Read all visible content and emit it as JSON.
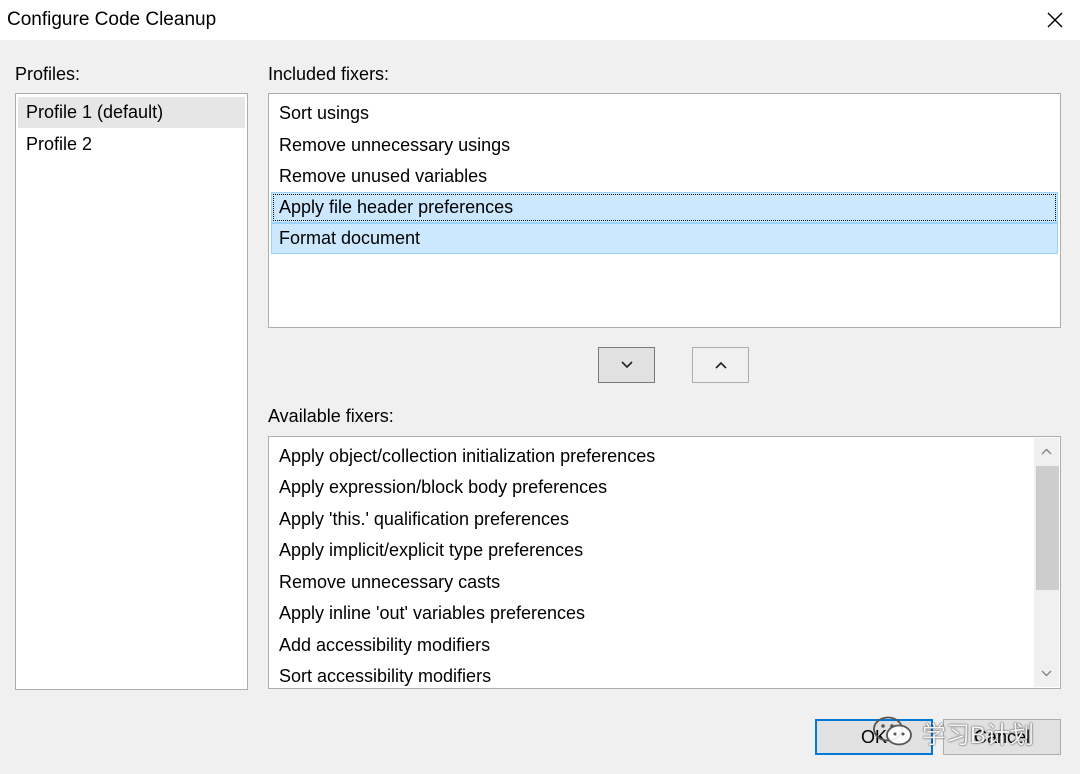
{
  "window": {
    "title": "Configure Code Cleanup",
    "close_icon": "close-icon"
  },
  "profiles": {
    "label": "Profiles:",
    "items": [
      {
        "label": "Profile 1 (default)",
        "selected": true
      },
      {
        "label": "Profile 2",
        "selected": false
      }
    ]
  },
  "included": {
    "label": "Included fixers:",
    "items": [
      {
        "label": "Sort usings",
        "selected": false
      },
      {
        "label": "Remove unnecessary usings",
        "selected": false
      },
      {
        "label": "Remove unused variables",
        "selected": false
      },
      {
        "label": "Apply file header preferences",
        "selected": true,
        "focused": true
      },
      {
        "label": "Format document",
        "selected": true
      }
    ]
  },
  "move_buttons": {
    "down_icon": "chevron-down-icon",
    "up_icon": "chevron-up-icon"
  },
  "available": {
    "label": "Available fixers:",
    "items": [
      {
        "label": "Apply object/collection initialization preferences"
      },
      {
        "label": "Apply expression/block body preferences"
      },
      {
        "label": "Apply 'this.' qualification preferences"
      },
      {
        "label": "Apply implicit/explicit type preferences"
      },
      {
        "label": "Remove unnecessary casts"
      },
      {
        "label": "Apply inline 'out' variables preferences"
      },
      {
        "label": "Add accessibility modifiers"
      },
      {
        "label": "Sort accessibility modifiers"
      }
    ]
  },
  "buttons": {
    "ok": "OK",
    "cancel": "Cancel"
  },
  "watermark": {
    "text": "学习B计划",
    "icon": "wechat-logo-icon"
  },
  "colors": {
    "selection_bg": "#cce8ff",
    "selection_border": "#99d1ff",
    "default_button_border": "#0078d7"
  }
}
